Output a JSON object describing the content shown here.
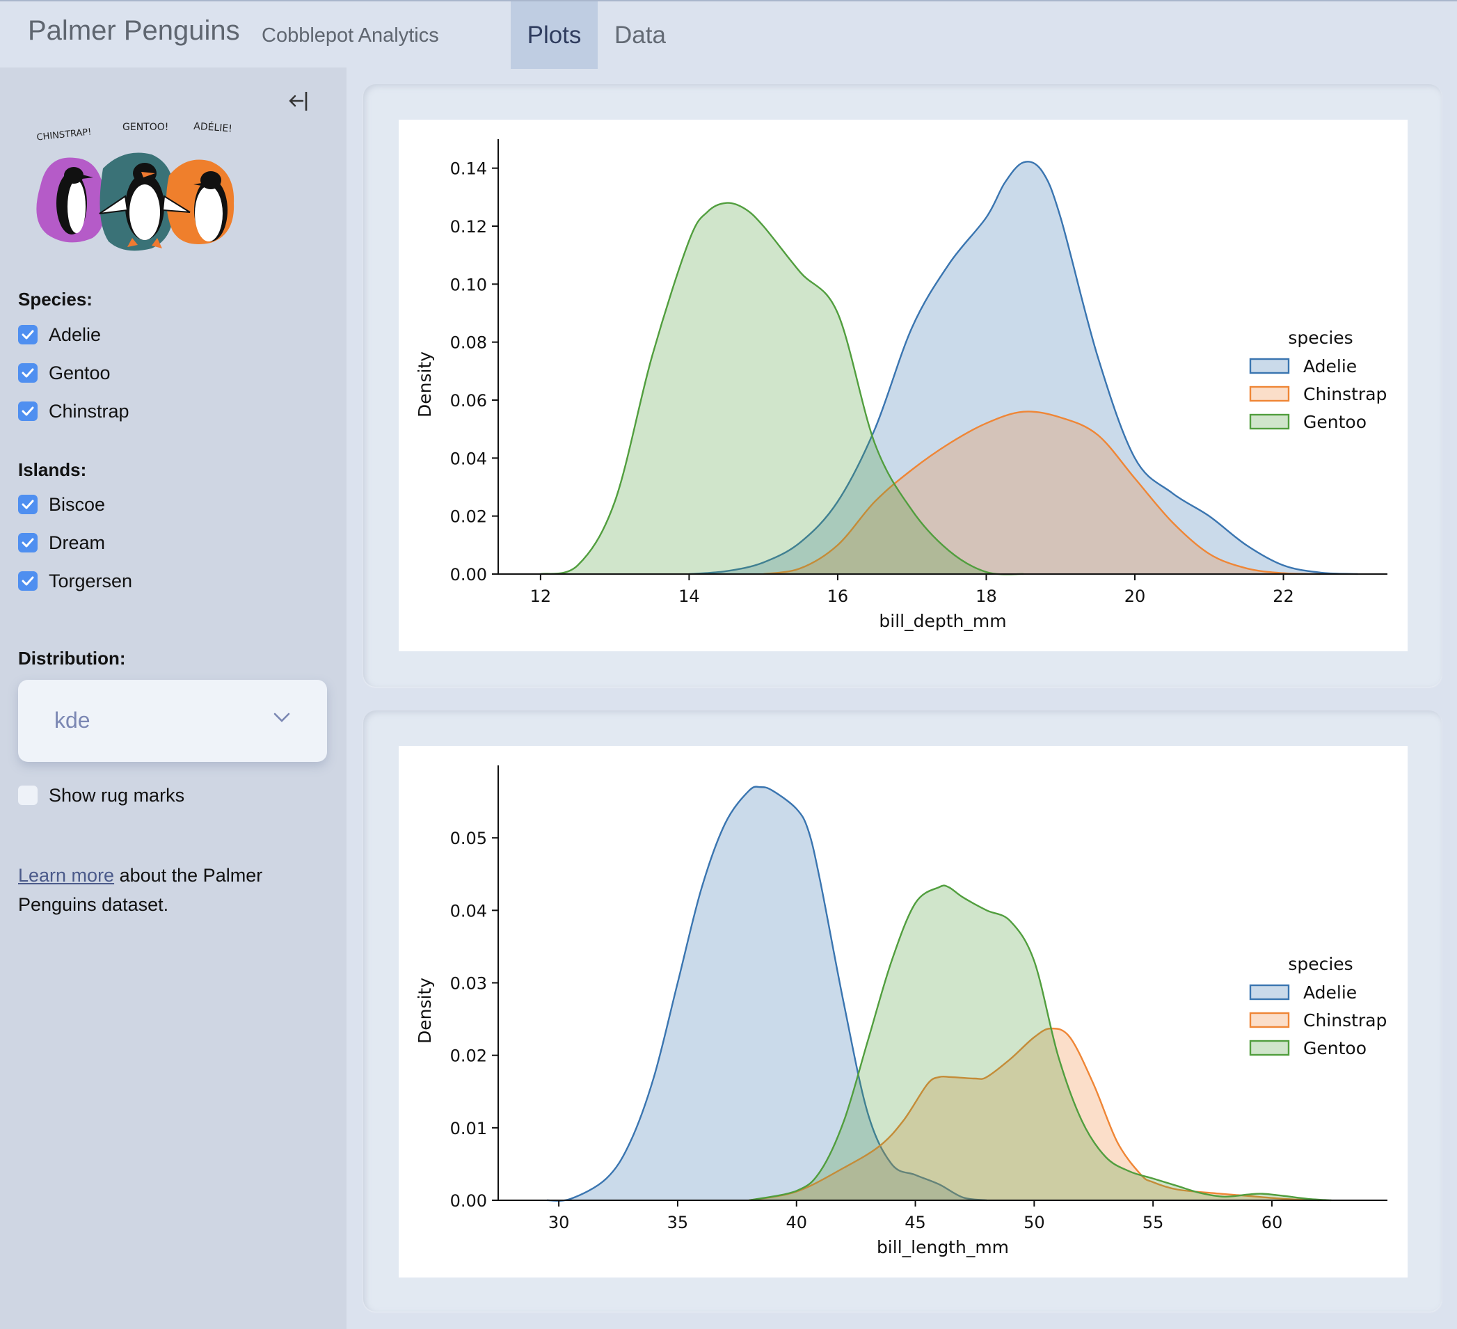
{
  "header": {
    "title": "Palmer Penguins",
    "subtitle": "Cobblepot Analytics",
    "tabs": [
      {
        "label": "Plots",
        "active": true
      },
      {
        "label": "Data",
        "active": false
      }
    ]
  },
  "sidebar": {
    "collapse_icon": "arrow-left-to-line",
    "logo_alt": "Penguin illustration",
    "logo_labels": [
      "CHINSTRAP!",
      "GENTOO!",
      "ADÉLIE!"
    ],
    "species_label": "Species:",
    "species": [
      {
        "label": "Adelie",
        "checked": true
      },
      {
        "label": "Gentoo",
        "checked": true
      },
      {
        "label": "Chinstrap",
        "checked": true
      }
    ],
    "islands_label": "Islands:",
    "islands": [
      {
        "label": "Biscoe",
        "checked": true
      },
      {
        "label": "Dream",
        "checked": true
      },
      {
        "label": "Torgersen",
        "checked": true
      }
    ],
    "distribution_label": "Distribution:",
    "distribution_value": "kde",
    "rug_label": "Show rug marks",
    "rug_checked": false,
    "about_link": "Learn more",
    "about_text": " about the Palmer Penguins dataset."
  },
  "colors": {
    "Adelie": "#3a75b0",
    "Chinstrap": "#ef8636",
    "Gentoo": "#519e3e",
    "checkbox": "#4f8ff0"
  },
  "chart_data": [
    {
      "type": "area",
      "title": "",
      "xlabel": "bill_depth_mm",
      "ylabel": "Density",
      "xlim": [
        11.43,
        23.4
      ],
      "ylim": [
        0,
        0.15
      ],
      "xticks": [
        12,
        14,
        16,
        18,
        20,
        22
      ],
      "xtick_labels": [
        "12",
        "14",
        "16",
        "18",
        "20",
        "22"
      ],
      "yticks": [
        0,
        0.02,
        0.04,
        0.06,
        0.08,
        0.1,
        0.12,
        0.14
      ],
      "ytick_labels": [
        "0.00",
        "0.02",
        "0.04",
        "0.06",
        "0.08",
        "0.10",
        "0.12",
        "0.14"
      ],
      "legend": {
        "title": "species",
        "placement": "right",
        "entries": [
          "Adelie",
          "Chinstrap",
          "Gentoo"
        ]
      },
      "series": [
        {
          "name": "Adelie",
          "x": [
            14.0,
            14.5,
            15.0,
            15.5,
            16.0,
            16.5,
            17.0,
            17.5,
            18.0,
            18.25,
            18.5,
            18.75,
            19.0,
            19.5,
            20.0,
            20.5,
            21.0,
            21.5,
            22.0,
            22.5,
            23.0
          ],
          "y": [
            0.0,
            0.001,
            0.004,
            0.011,
            0.025,
            0.05,
            0.085,
            0.107,
            0.123,
            0.135,
            0.142,
            0.139,
            0.123,
            0.075,
            0.04,
            0.028,
            0.02,
            0.01,
            0.003,
            0.0005,
            0.0
          ]
        },
        {
          "name": "Chinstrap",
          "x": [
            15.0,
            15.5,
            16.0,
            16.5,
            17.0,
            17.5,
            18.0,
            18.5,
            19.0,
            19.5,
            20.0,
            20.5,
            21.0,
            21.5,
            22.0,
            22.5
          ],
          "y": [
            0.0,
            0.002,
            0.01,
            0.025,
            0.036,
            0.045,
            0.052,
            0.056,
            0.054,
            0.048,
            0.033,
            0.018,
            0.007,
            0.002,
            0.0003,
            0.0
          ]
        },
        {
          "name": "Gentoo",
          "x": [
            12.0,
            12.5,
            13.0,
            13.5,
            14.0,
            14.25,
            14.5,
            14.75,
            15.0,
            15.5,
            16.0,
            16.5,
            17.0,
            17.5,
            18.0,
            18.5
          ],
          "y": [
            0.0,
            0.003,
            0.025,
            0.075,
            0.115,
            0.125,
            0.128,
            0.126,
            0.12,
            0.104,
            0.09,
            0.045,
            0.022,
            0.008,
            0.0007,
            0.0
          ]
        }
      ]
    },
    {
      "type": "area",
      "title": "",
      "xlabel": "bill_length_mm",
      "ylabel": "Density",
      "xlim": [
        27.45,
        64.86
      ],
      "ylim": [
        0,
        0.06
      ],
      "xticks": [
        30,
        35,
        40,
        45,
        50,
        55,
        60
      ],
      "xtick_labels": [
        "30",
        "35",
        "40",
        "45",
        "50",
        "55",
        "60"
      ],
      "yticks": [
        0,
        0.01,
        0.02,
        0.03,
        0.04,
        0.05
      ],
      "ytick_labels": [
        "0.00",
        "0.01",
        "0.02",
        "0.03",
        "0.04",
        "0.05"
      ],
      "legend": {
        "title": "species",
        "placement": "right",
        "entries": [
          "Adelie",
          "Chinstrap",
          "Gentoo"
        ]
      },
      "series": [
        {
          "name": "Adelie",
          "x": [
            29.5,
            30.5,
            32.0,
            33.0,
            34.0,
            35.0,
            36.0,
            37.0,
            38.0,
            38.5,
            39.0,
            40.0,
            40.5,
            41.0,
            42.0,
            43.0,
            44.0,
            45.0,
            46.0,
            47.0,
            48.0
          ],
          "y": [
            0.0,
            0.0002,
            0.003,
            0.008,
            0.017,
            0.03,
            0.043,
            0.052,
            0.0565,
            0.057,
            0.0565,
            0.054,
            0.051,
            0.044,
            0.027,
            0.012,
            0.005,
            0.0035,
            0.0022,
            0.0004,
            0.0
          ]
        },
        {
          "name": "Chinstrap",
          "x": [
            38.0,
            40.0,
            42.0,
            43.5,
            44.5,
            45.5,
            46.0,
            46.5,
            47.5,
            48.0,
            49.0,
            50.0,
            50.7,
            51.5,
            52.5,
            53.5,
            54.5,
            55.0,
            56.0,
            57.5,
            59.0,
            60.5,
            62.0
          ],
          "y": [
            0.0,
            0.0012,
            0.0045,
            0.0075,
            0.011,
            0.016,
            0.017,
            0.017,
            0.0168,
            0.017,
            0.0195,
            0.0225,
            0.0237,
            0.0225,
            0.016,
            0.008,
            0.0035,
            0.0025,
            0.0015,
            0.001,
            0.0006,
            0.0002,
            0.0
          ]
        },
        {
          "name": "Gentoo",
          "x": [
            38.0,
            40.0,
            41.0,
            42.0,
            43.0,
            44.0,
            45.0,
            46.0,
            46.4,
            47.0,
            48.0,
            49.0,
            50.0,
            51.0,
            52.0,
            53.0,
            54.0,
            55.0,
            56.0,
            57.0,
            58.0,
            59.0,
            59.6,
            60.5,
            61.5,
            62.5
          ],
          "y": [
            0.0,
            0.0013,
            0.004,
            0.011,
            0.022,
            0.033,
            0.041,
            0.0432,
            0.0432,
            0.0418,
            0.04,
            0.0385,
            0.033,
            0.02,
            0.011,
            0.006,
            0.004,
            0.003,
            0.002,
            0.001,
            0.0005,
            0.0008,
            0.0009,
            0.0006,
            0.0002,
            0.0
          ]
        }
      ]
    }
  ]
}
